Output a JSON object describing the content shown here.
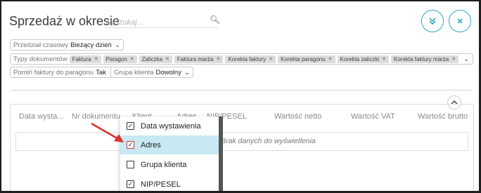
{
  "header": {
    "title": "Sprzedaż w okresie"
  },
  "search": {
    "placeholder": "wyszukaj..."
  },
  "icons": {
    "search": "search-icon",
    "expand": "double-chevron-down-icon",
    "close": "close-icon",
    "collapse": "chevron-up-icon"
  },
  "colors": {
    "accent": "#2fa8c6",
    "highlight": "#c8e8f2",
    "arrow": "#d9302c"
  },
  "filters": {
    "period": {
      "label": "Przedział czasowy",
      "value": "Bieżący dzień"
    },
    "doc_types": {
      "label": "Typy dokumentów",
      "tags": [
        "Faktura",
        "Paragon",
        "Zaliczka",
        "Faktura marża",
        "Korekta faktury",
        "Korekta paragonu",
        "Korekta zaliczki",
        "Korekta faktury marża"
      ]
    },
    "skip_invoices": {
      "label": "Pomiń faktury do paragonu",
      "value": "Tak"
    },
    "client_group": {
      "label": "Grupa klienta",
      "value": "Dowolny"
    }
  },
  "table": {
    "columns": [
      "Data wysta...",
      "Nr dokumentu",
      "Klient",
      "Adres",
      "NIP/PESEL",
      "Wartość netto",
      "Wartość VAT",
      "Wartość brutto"
    ],
    "empty_text": "Brak danych do wyświetlenia"
  },
  "column_menu": {
    "items": [
      {
        "label": "Data wystawienia",
        "checked": true
      },
      {
        "label": "Adres",
        "checked": true
      },
      {
        "label": "Grupa klienta",
        "checked": false
      },
      {
        "label": "NIP/PESEL",
        "checked": true
      }
    ]
  }
}
